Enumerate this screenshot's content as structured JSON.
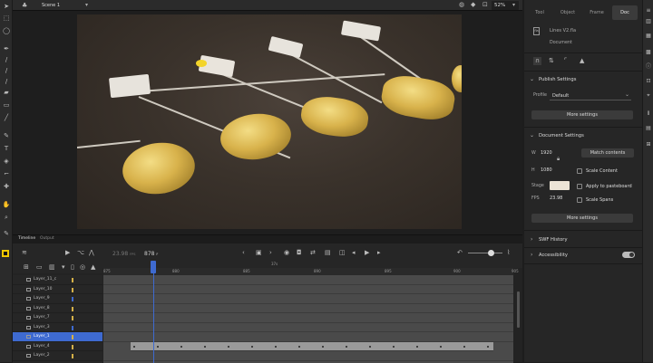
{
  "app": {
    "scene_label": "Scene 1",
    "zoom": "52%"
  },
  "timeline": {
    "tab_timeline": "Timeline",
    "tab_output": "Output",
    "fps": "23.98",
    "fps_unit": "FPS",
    "frame": "878",
    "frame_unit": "F",
    "ruler_label": "37s",
    "ruler_ticks": [
      "875",
      "880",
      "885",
      "890",
      "895",
      "900",
      "905"
    ],
    "layers": [
      {
        "name": "Layer_11_c",
        "color": "#d4b048"
      },
      {
        "name": "Layer_10",
        "color": "#d4b048"
      },
      {
        "name": "Layer_9",
        "color": "#3e6ad0"
      },
      {
        "name": "Layer_8",
        "color": "#d4b048"
      },
      {
        "name": "Layer_7",
        "color": "#d4b048"
      },
      {
        "name": "Layer_3",
        "color": "#3e6ad0"
      },
      {
        "name": "Layer_1",
        "color": "#d4b048"
      },
      {
        "name": "Layer_4",
        "color": "#d4b048"
      },
      {
        "name": "Layer_2",
        "color": "#d4b048"
      }
    ]
  },
  "properties": {
    "tabs": [
      "Tool",
      "Object",
      "Frame",
      "Doc"
    ],
    "doc_name": "Lines V2.fla",
    "doc_type": "Document",
    "publish_settings": {
      "title": "Publish Settings",
      "profile_label": "Profile",
      "profile_value": "Default",
      "more_settings": "More settings"
    },
    "document_settings": {
      "title": "Document Settings",
      "w_label": "W",
      "width": "1920",
      "h_label": "H",
      "height": "1080",
      "match_contents": "Match contents",
      "scale_content": "Scale Content",
      "stage_label": "Stage",
      "apply_pasteboard": "Apply to pasteboard",
      "fps_label": "FPS",
      "fps": "23.98",
      "scale_spans": "Scale Spans",
      "more_settings": "More settings"
    },
    "swf_history": "SWF History",
    "accessibility": "Accessibility"
  },
  "colors": {
    "accent": "#3e6ad0",
    "stage_color": "#ece4d6"
  }
}
